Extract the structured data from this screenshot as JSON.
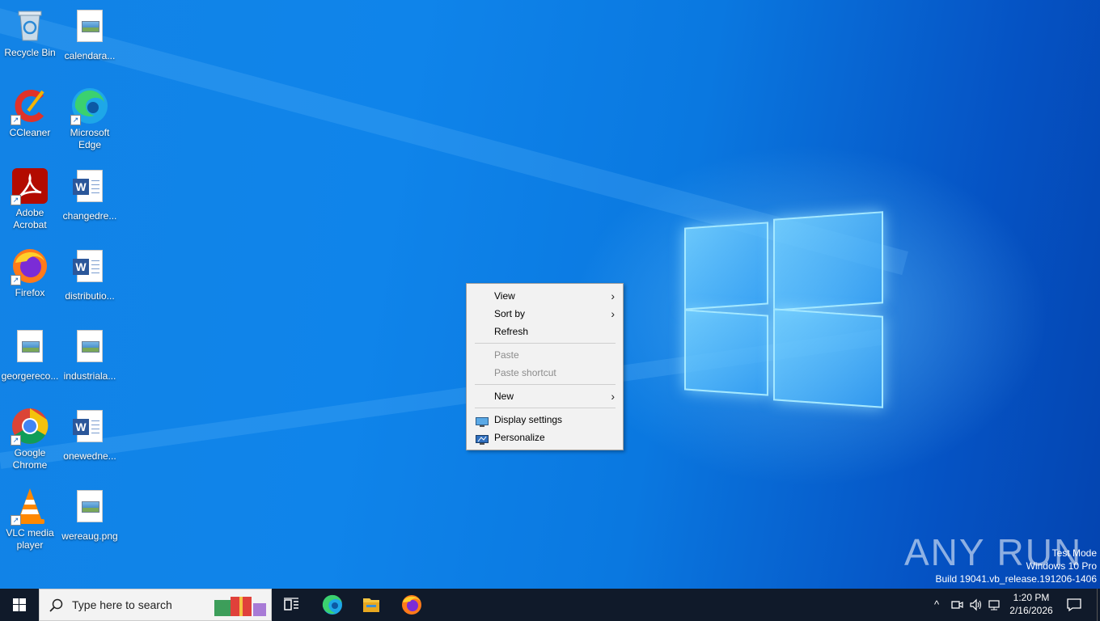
{
  "desktop_icons": [
    {
      "label": "Recycle Bin",
      "icon": "recycle-bin-icon"
    },
    {
      "label": "calendara...",
      "icon": "image-file-icon"
    },
    {
      "label": "CCleaner",
      "icon": "ccleaner-icon"
    },
    {
      "label": "Microsoft Edge",
      "icon": "edge-icon"
    },
    {
      "label": "Adobe Acrobat",
      "icon": "acrobat-icon"
    },
    {
      "label": "changedre...",
      "icon": "word-document-icon"
    },
    {
      "label": "Firefox",
      "icon": "firefox-icon"
    },
    {
      "label": "distributio...",
      "icon": "word-document-icon"
    },
    {
      "label": "georgereco...",
      "icon": "image-file-icon"
    },
    {
      "label": "industriala...",
      "icon": "image-file-icon"
    },
    {
      "label": "Google Chrome",
      "icon": "chrome-icon"
    },
    {
      "label": "onewedne...",
      "icon": "word-document-icon"
    },
    {
      "label": "VLC media player",
      "icon": "vlc-icon"
    },
    {
      "label": "wereaug.png",
      "icon": "image-file-icon"
    }
  ],
  "context_menu": {
    "items": [
      {
        "label": "View",
        "submenu": true,
        "enabled": true
      },
      {
        "label": "Sort by",
        "submenu": true,
        "enabled": true
      },
      {
        "label": "Refresh",
        "enabled": true
      },
      {
        "label": "Paste",
        "enabled": false
      },
      {
        "label": "Paste shortcut",
        "enabled": false
      },
      {
        "label": "New",
        "submenu": true,
        "enabled": true
      },
      {
        "label": "Display settings",
        "icon": "display-icon",
        "enabled": true
      },
      {
        "label": "Personalize",
        "icon": "personalize-icon",
        "enabled": true
      }
    ]
  },
  "watermark": {
    "line1": "Test Mode",
    "line2": "Windows 10 Pro",
    "line3": "Build 19041.vb_release.191206-1406",
    "brand": "ANY RUN"
  },
  "taskbar": {
    "search_placeholder": "Type here to search",
    "pinned": [
      "task-view-icon",
      "edge-icon",
      "file-explorer-icon",
      "firefox-icon"
    ],
    "clock_time": "1:20 PM",
    "clock_date": "2/16/2026"
  },
  "colors": {
    "taskbar": "#101a2a",
    "menu_bg": "#f2f2f2",
    "wallpaper": "#0a78e0"
  }
}
